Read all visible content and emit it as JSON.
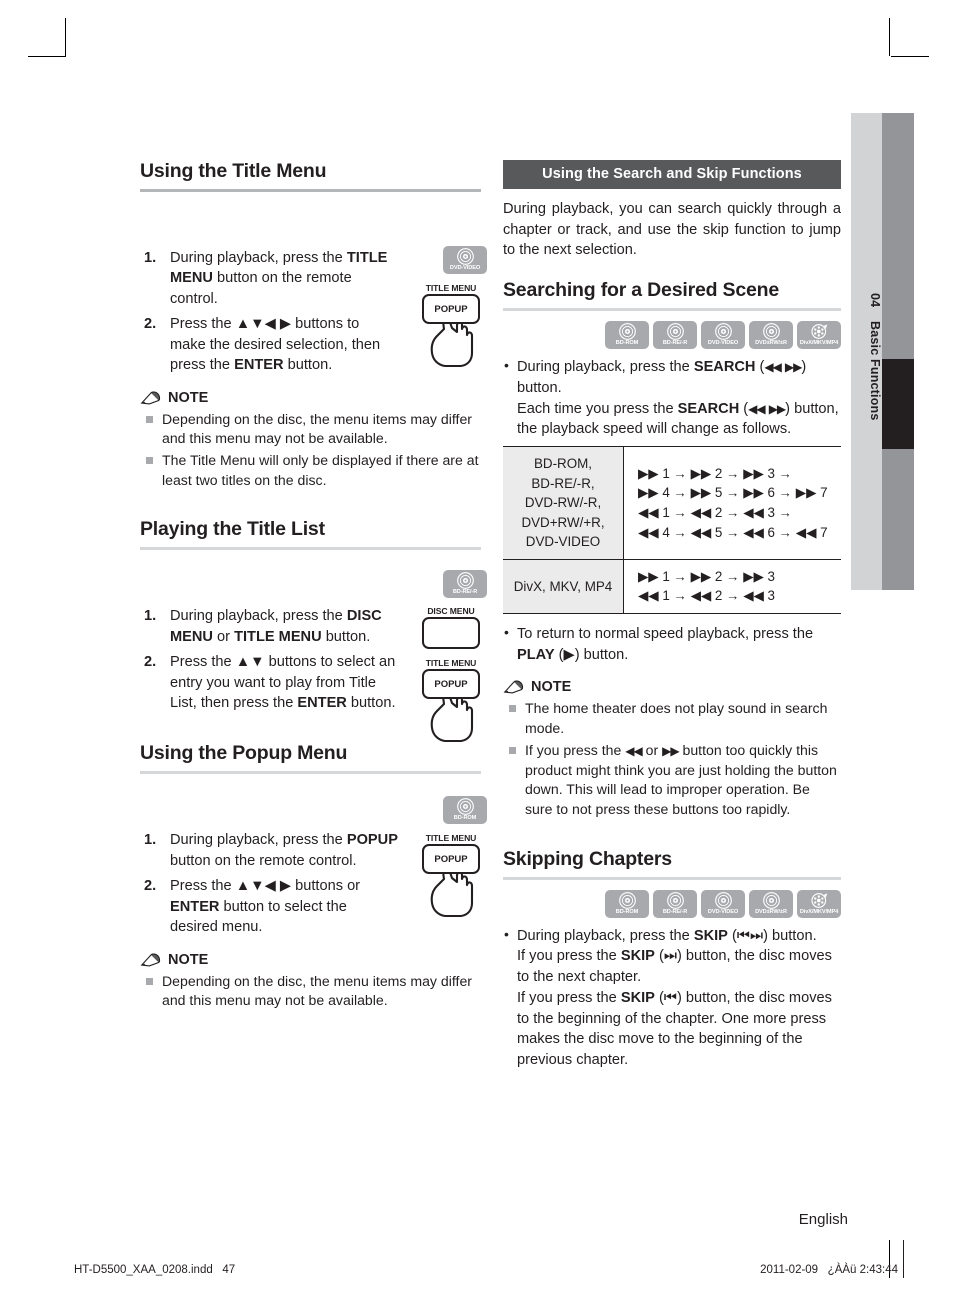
{
  "page": {
    "language_footer": "English",
    "footer_file": "HT-D5500_XAA_0208.indd   47",
    "footer_date": "2011-02-09   ¿ÀÀü 2:43:44"
  },
  "side_tab": {
    "chapter_number": "04",
    "chapter_title": "Basic Functions",
    "light_color": "#d2d3d5",
    "grey_color": "#939598",
    "black_color": "#231f20"
  },
  "left_column": {
    "section1": {
      "heading": "Using the Title Menu",
      "badge": {
        "label": "DVD-VIDEO",
        "icon": "disc-icon"
      },
      "remote": {
        "top_label": "TITLE MENU",
        "button_label": "POPUP",
        "hand_icon": "hand-pressing-icon"
      },
      "steps": [
        {
          "num": "1.",
          "html": "During playback, press the <b>TITLE MENU</b> button on the remote control."
        },
        {
          "num": "2.",
          "html": "Press the ▲▼◀ ▶ buttons to make the desired selection, then press the <b>ENTER</b> button."
        }
      ],
      "note_label": "NOTE",
      "notes": [
        "Depending on the disc, the menu items may differ and this menu may not be available.",
        "The Title Menu will only be displayed if there are at least two titles on the disc."
      ]
    },
    "section2": {
      "heading": "Playing the Title List",
      "badge": {
        "label": "BD-RE/-R",
        "icon": "disc-icon"
      },
      "remote": {
        "disc_menu_label": "DISC MENU",
        "disc_menu_button": "",
        "title_menu_label": "TITLE MENU",
        "popup_button": "POPUP",
        "hand_icon": "hand-pressing-icon"
      },
      "steps": [
        {
          "num": "1.",
          "html": "During playback, press the <b>DISC MENU</b> or <b>TITLE MENU</b> button."
        },
        {
          "num": "2.",
          "html": "Press the ▲▼ buttons to select an entry you want to play from Title List, then press the <b>ENTER</b> button."
        }
      ]
    },
    "section3": {
      "heading": "Using the Popup Menu",
      "badge": {
        "label": "BD-ROM",
        "icon": "disc-icon"
      },
      "remote": {
        "top_label": "TITLE MENU",
        "button_label": "POPUP",
        "hand_icon": "hand-pressing-icon"
      },
      "steps": [
        {
          "num": "1.",
          "html": "During playback, press the <b>POPUP</b> button on the remote control."
        },
        {
          "num": "2.",
          "html": "Press the ▲▼◀ ▶ buttons or <b>ENTER</b> button to select the desired menu."
        }
      ],
      "note_label": "NOTE",
      "notes": [
        "Depending on the disc, the menu items may differ and this menu may not be available."
      ]
    }
  },
  "right_column": {
    "bar_heading": "Using the Search and Skip Functions",
    "bar_color": "#58595b",
    "intro": "During playback, you can search quickly through a chapter or track, and use the skip function to jump to the next selection.",
    "section_search": {
      "heading": "Searching for a Desired Scene",
      "badges": [
        "BD-ROM",
        "BD-RE/-R",
        "DVD-VIDEO",
        "DVD±RW/±R",
        "DivX/MKV/MP4"
      ],
      "bullet1_html": "During playback, press the <b>SEARCH</b> (<span class=\"seq\"><span class=\"rw\">◀◀</span> <span class=\"ff\">▶▶</span></span>) button.<br>Each time you press the <b>SEARCH</b> (<span class=\"seq\"><span class=\"rw\">◀◀</span> <span class=\"ff\">▶▶</span></span>) button, the playback speed will change as follows.",
      "table": {
        "rows": [
          {
            "discs": [
              "BD-ROM,",
              "BD-RE/-R,",
              "DVD-RW/-R,",
              "DVD+RW/+R,",
              "DVD-VIDEO"
            ],
            "sequences": [
              "▶▶ 1 → ▶▶ 2 → ▶▶ 3 →",
              "▶▶ 4 → ▶▶ 5 → ▶▶ 6 → ▶▶ 7",
              "◀◀ 1 → ◀◀ 2 → ◀◀ 3 →",
              "◀◀ 4 → ◀◀ 5 → ◀◀ 6 → ◀◀ 7"
            ]
          },
          {
            "discs": [
              "DivX, MKV, MP4"
            ],
            "sequences": [
              "▶▶ 1 → ▶▶ 2 → ▶▶ 3",
              "◀◀ 1 → ◀◀ 2 → ◀◀ 3"
            ]
          }
        ]
      },
      "bullet2_html": "To return to normal speed playback, press the <b>PLAY</b> (▶) button.",
      "note_label": "NOTE",
      "notes_html": [
        "The home theater does not play sound in search mode.",
        "If you press the <span class=\"seq\"><span class=\"rw\">◀◀</span></span> or <span class=\"seq\"><span class=\"ff\">▶▶</span></span> button too quickly this product might think you are just holding the button down.  This will lead to improper operation. Be sure to not press these buttons too rapidly."
      ]
    },
    "section_skip": {
      "heading": "Skipping Chapters",
      "badges": [
        "BD-ROM",
        "BD-RE/-R",
        "DVD-VIDEO",
        "DVD±RW/±R",
        "DivX/MKV/MP4"
      ],
      "bullet_html": "During playback, press the <b>SKIP</b> (<span class=\"seq\">⏮⏭</span>) button.<br>If you press the <b>SKIP</b> (<span class=\"seq\">⏭</span>) button, the disc moves to the next chapter.<br>If you press the <b>SKIP</b> (<span class=\"seq\">⏮</span>) button, the disc moves to the beginning of the chapter. One more press makes the disc move to the beginning of the previous chapter."
    }
  }
}
